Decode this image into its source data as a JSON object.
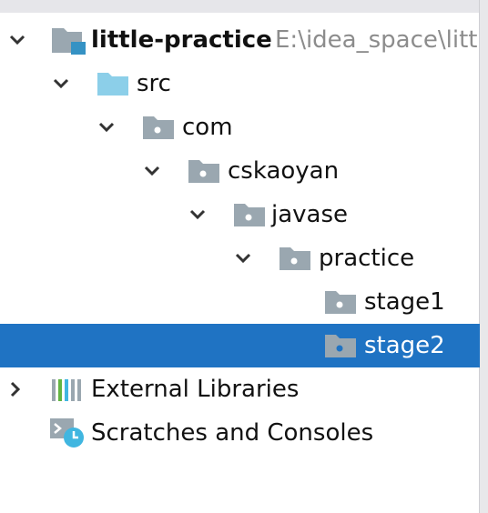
{
  "tree": {
    "root": {
      "label": "little-practice",
      "path": "E:\\idea_space\\litt"
    },
    "src": {
      "label": "src"
    },
    "com": {
      "label": "com"
    },
    "cskaoyan": {
      "label": "cskaoyan"
    },
    "javase": {
      "label": "javase"
    },
    "practice": {
      "label": "practice"
    },
    "stage1": {
      "label": "stage1"
    },
    "stage2": {
      "label": "stage2"
    },
    "external_libraries": {
      "label": "External Libraries"
    },
    "scratches": {
      "label": "Scratches and Consoles"
    }
  },
  "colors": {
    "selection": "#1f73c3",
    "folder_gray": "#9aa7b0",
    "folder_source": "#8ccfe9",
    "module_blue": "#3592c4"
  },
  "icons": {
    "root": "module-folder-icon",
    "src": "source-folder-icon",
    "package": "package-folder-icon",
    "libraries": "libraries-icon",
    "scratches": "scratches-icon"
  }
}
